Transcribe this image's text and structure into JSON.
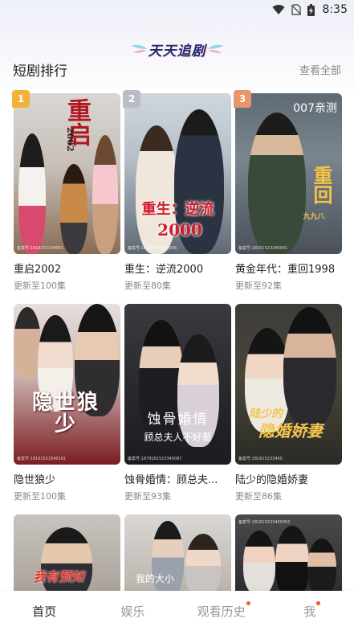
{
  "status_bar": {
    "time": "8:35",
    "icons": [
      "wifi-icon",
      "sim-no-signal-icon",
      "battery-charging-icon"
    ]
  },
  "logo": {
    "text": "天天追剧"
  },
  "section": {
    "title": "短剧排行",
    "more_label": "查看全部"
  },
  "cards": [
    {
      "rank": "1",
      "title": "重启2002",
      "subtitle": "更新至100集",
      "poster_title": "重启",
      "poster_subtitle": "2002",
      "footer": "备案号:1819152334061",
      "rank_color": "#f2b23a"
    },
    {
      "rank": "2",
      "title": "重生：逆流2000",
      "subtitle": "更新至80集",
      "poster_title": "重生：逆流",
      "poster_subtitle": "2000",
      "footer": "备案号:18161523340006",
      "rank_color": "#b8bcc6"
    },
    {
      "rank": "3",
      "title": "黄金年代：重回1998",
      "subtitle": "更新至92集",
      "poster_title": "重回",
      "poster_subtitle": "九九八",
      "footer": "备案号:18161523340001",
      "rank_color": "#e8956a",
      "corner_tag": "007亲测"
    },
    {
      "title": "隐世狼少",
      "subtitle": "更新至100集",
      "poster_title": "隐世狼少",
      "footer": "备案号:18161523340161"
    },
    {
      "title": "蚀骨婚情：顾总夫...",
      "subtitle": "更新至93集",
      "poster_title": "蚀骨婚情",
      "poster_subtitle": "顾总夫人不好惹",
      "footer": "备案号:1879161523340087"
    },
    {
      "title": "陆少的隐婚娇妻",
      "subtitle": "更新至86集",
      "poster_title": "陆少的",
      "poster_subtitle": "隐婚娇妻",
      "footer": "备案号:181615233400"
    },
    {
      "poster_title": "我有预知",
      "footer": ""
    },
    {
      "poster_title": "我的大小",
      "footer": ""
    },
    {
      "poster_title": "",
      "footer": "备案号:181615233400062"
    }
  ],
  "nav": {
    "items": [
      {
        "label": "首页",
        "active": true
      },
      {
        "label": "娱乐",
        "active": false
      },
      {
        "label": "观看历史",
        "active": false,
        "dot": true
      },
      {
        "label": "我",
        "active": false,
        "dot": true
      }
    ]
  },
  "colors": {
    "badge_gold": "#f2b23a",
    "badge_silver": "#b8bcc6",
    "badge_bronze": "#e8956a",
    "notification_dot": "#f05a2a"
  }
}
